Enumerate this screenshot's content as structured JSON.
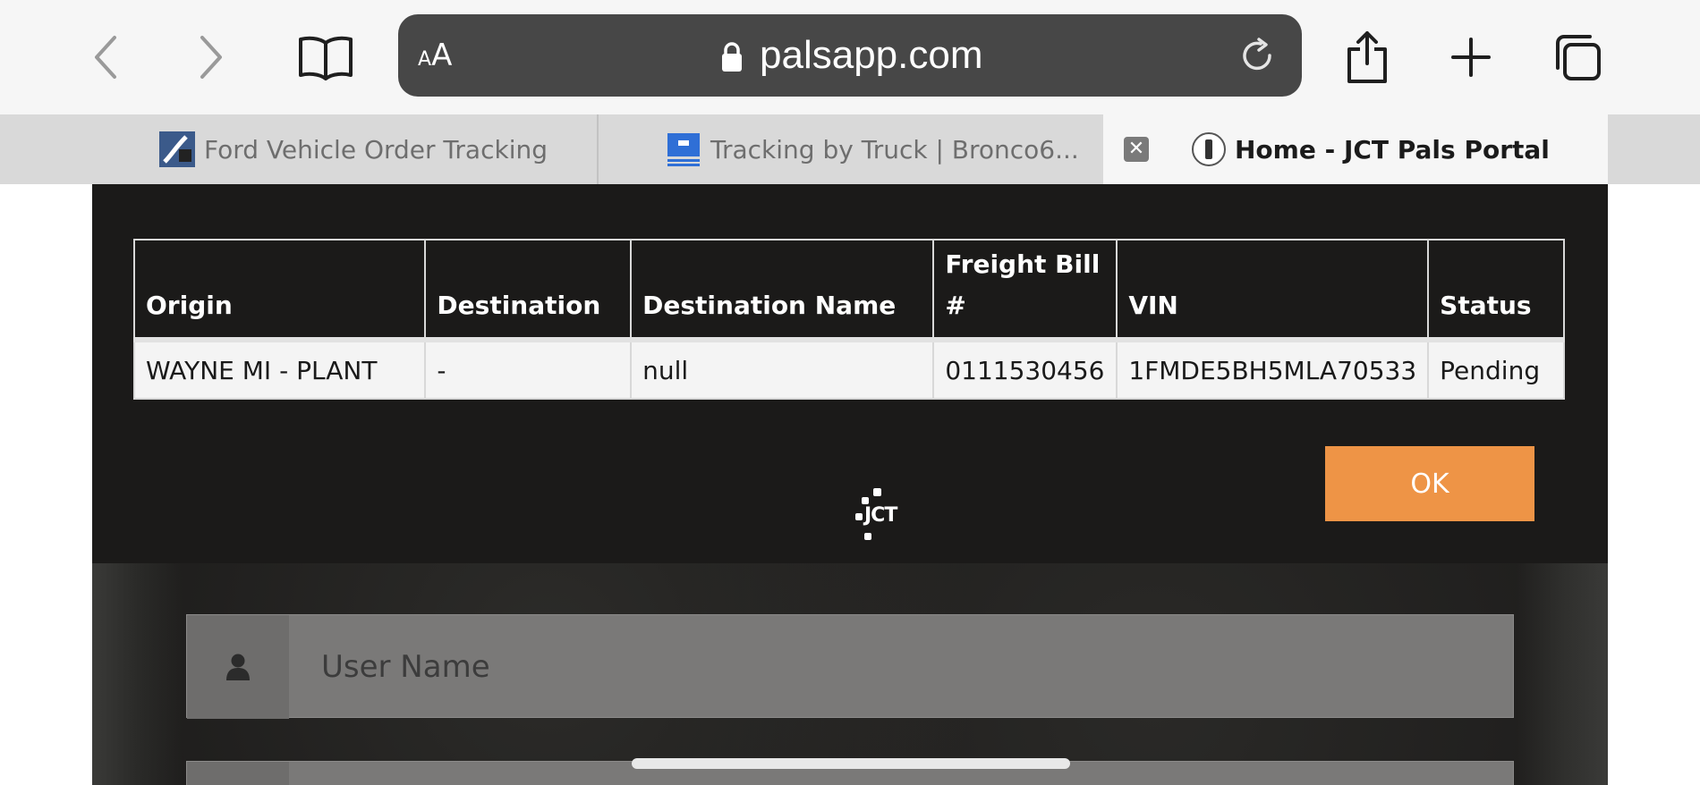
{
  "browser": {
    "aa_label_small": "A",
    "aa_label_large": "A",
    "url": "palsapp.com",
    "tabs": [
      {
        "label": "Ford Vehicle Order Tracking"
      },
      {
        "label": "Tracking by Truck | Bronco6..."
      },
      {
        "label": "Home - JCT Pals Portal"
      }
    ],
    "tab_close_glyph": "✕"
  },
  "table": {
    "headers": [
      "Origin",
      "Destination",
      "Destination Name",
      "Freight Bill #",
      "VIN",
      "Status"
    ],
    "header_line1": [
      "",
      "",
      "",
      "Freight Bill",
      "",
      ""
    ],
    "header_line2": [
      "Origin",
      "Destination",
      "Destination Name",
      "#",
      "VIN",
      "Status"
    ],
    "rows": [
      [
        "WAYNE MI - PLANT",
        "-",
        "null",
        "0111530456",
        "1FMDE5BH5MLA70533",
        "Pending"
      ]
    ]
  },
  "ok_label": "OK",
  "logo_text": "JCT",
  "login": {
    "username_placeholder": "User Name"
  },
  "colors": {
    "accent": "#ee9446",
    "page_bg": "#1b1a19",
    "url_bar": "#474747"
  },
  "icons": {
    "back": "chevron-left-icon",
    "forward": "chevron-right-icon",
    "bookmarks": "book-icon",
    "lock": "lock-icon",
    "reload": "reload-icon",
    "share": "share-icon",
    "new_tab": "plus-icon",
    "tabs": "tabs-icon",
    "user": "user-icon"
  }
}
